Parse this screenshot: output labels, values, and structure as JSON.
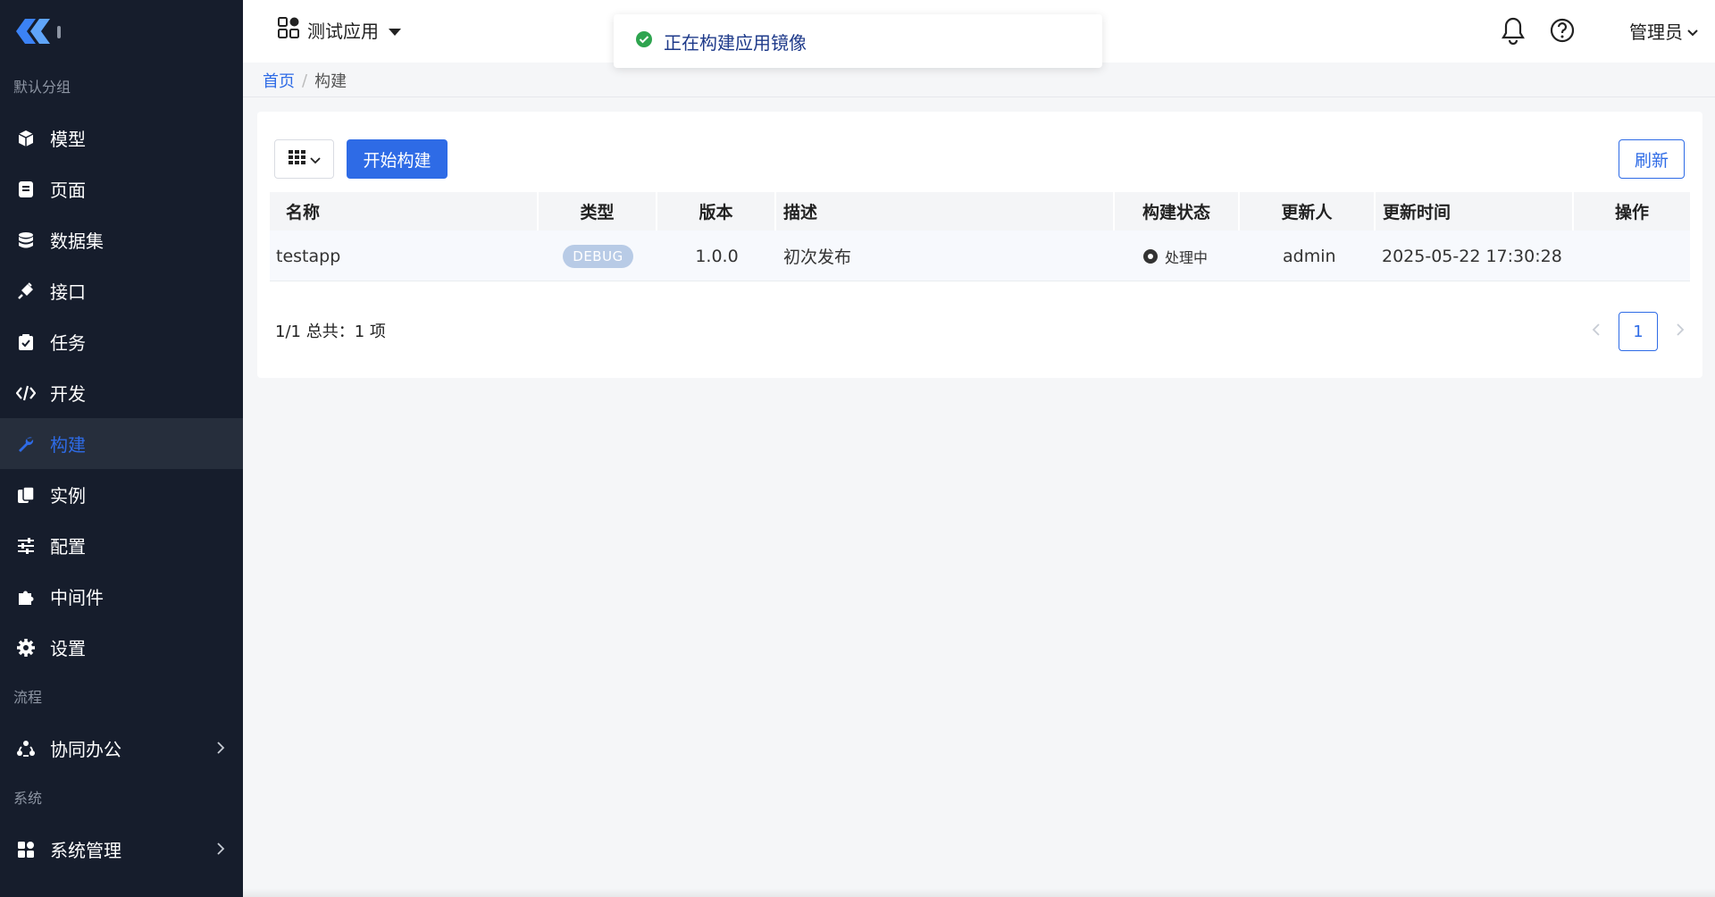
{
  "sidebar": {
    "groups": [
      {
        "label": "默认分组",
        "items": [
          {
            "label": "模型",
            "icon": "cube-icon"
          },
          {
            "label": "页面",
            "icon": "page-icon"
          },
          {
            "label": "数据集",
            "icon": "database-icon"
          },
          {
            "label": "接口",
            "icon": "plug-icon"
          },
          {
            "label": "任务",
            "icon": "clipboard-check-icon"
          },
          {
            "label": "开发",
            "icon": "code-icon"
          },
          {
            "label": "构建",
            "icon": "wrench-icon",
            "active": true
          },
          {
            "label": "实例",
            "icon": "copy-icon"
          },
          {
            "label": "配置",
            "icon": "sliders-icon"
          },
          {
            "label": "中间件",
            "icon": "puzzle-icon"
          },
          {
            "label": "设置",
            "icon": "gear-icon"
          }
        ]
      },
      {
        "label": "流程",
        "items": [
          {
            "label": "协同办公",
            "icon": "users-cycle-icon"
          }
        ]
      },
      {
        "label": "系统",
        "items": [
          {
            "label": "系统管理",
            "icon": "grid-icon"
          }
        ]
      }
    ]
  },
  "header": {
    "app_name": "测试应用",
    "admin_label": "管理员"
  },
  "toast": {
    "message": "正在构建应用镜像"
  },
  "breadcrumb": {
    "home": "首页",
    "separator": "/",
    "current": "构建"
  },
  "toolbar": {
    "start_label": "开始构建",
    "refresh_label": "刷新"
  },
  "table": {
    "columns": [
      "名称",
      "类型",
      "版本",
      "描述",
      "构建状态",
      "更新人",
      "更新时间",
      "操作"
    ],
    "rows": [
      {
        "name": "testapp",
        "type": "DEBUG",
        "version": "1.0.0",
        "description": "初次发布",
        "status": "处理中",
        "updater": "admin",
        "updated_at": "2025-05-22 17:30:28",
        "actions": ""
      }
    ]
  },
  "pagination": {
    "summary": "1/1 总共：1 项",
    "current_page": "1"
  },
  "colors": {
    "accent": "#2e6be6",
    "sidebar_bg": "#161d2c",
    "success": "#2ea44f"
  }
}
